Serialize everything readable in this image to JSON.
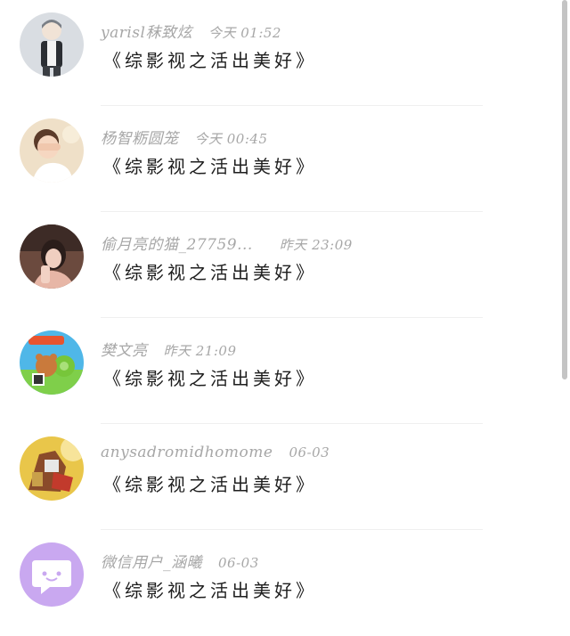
{
  "comments": [
    {
      "user": "yarisl秣致炫",
      "time": "今天 01:52",
      "text": "《综影视之活出美好》",
      "avatar": "avatar-boy-illustration"
    },
    {
      "user": "杨智粝圆笼",
      "time": "今天 00:45",
      "text": "《综影视之活出美好》",
      "avatar": "avatar-person-covering-eyes"
    },
    {
      "user": "偷月亮的猫_27759...",
      "time": "昨天 23:09",
      "text": "《综影视之活出美好》",
      "avatar": "avatar-girl-photo"
    },
    {
      "user": "樊文亮",
      "time": "昨天 21:09",
      "text": "《综影视之活出美好》",
      "avatar": "avatar-game-bear"
    },
    {
      "user": "anysadromidhomome",
      "time": "06-03",
      "text": "《综影视之活出美好》",
      "avatar": "avatar-game-character"
    },
    {
      "user": "微信用户_涵曦",
      "time": "06-03",
      "text": "《综影视之活出美好》",
      "avatar": "avatar-chat-bubble-default"
    }
  ]
}
